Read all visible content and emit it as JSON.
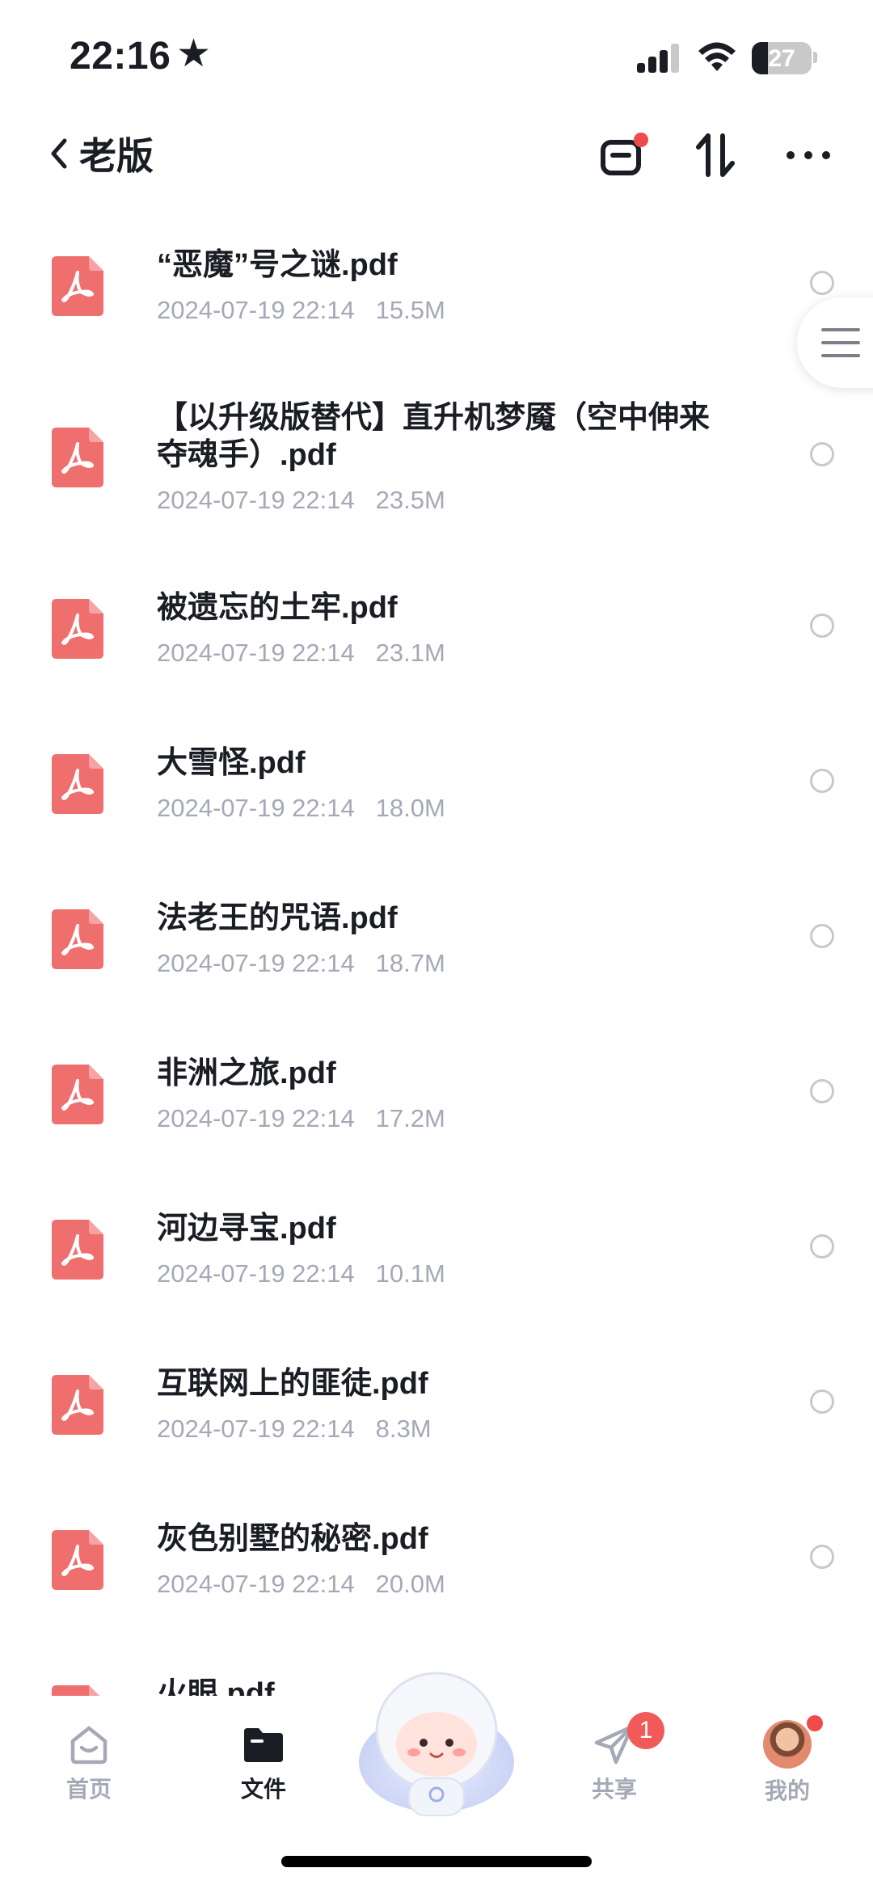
{
  "status_bar": {
    "time": "22:16",
    "star": "★",
    "battery_level": "27",
    "battery_fraction": 0.27
  },
  "header": {
    "back_label": "老版"
  },
  "files": [
    {
      "name_lines": [
        "“恶魔”号之谜.pdf"
      ],
      "date": "2024-07-19 22:14",
      "size": "15.5M"
    },
    {
      "name_lines": [
        "【以升级版替代】直升机梦魇（空中伸来",
        "夺魂手）.pdf"
      ],
      "date": "2024-07-19 22:14",
      "size": "23.5M"
    },
    {
      "name_lines": [
        "被遗忘的土牢.pdf"
      ],
      "date": "2024-07-19 22:14",
      "size": "23.1M"
    },
    {
      "name_lines": [
        "大雪怪.pdf"
      ],
      "date": "2024-07-19 22:14",
      "size": "18.0M"
    },
    {
      "name_lines": [
        "法老王的咒语.pdf"
      ],
      "date": "2024-07-19 22:14",
      "size": "18.7M"
    },
    {
      "name_lines": [
        "非洲之旅.pdf"
      ],
      "date": "2024-07-19 22:14",
      "size": "17.2M"
    },
    {
      "name_lines": [
        "河边寻宝.pdf"
      ],
      "date": "2024-07-19 22:14",
      "size": "10.1M"
    },
    {
      "name_lines": [
        "互联网上的匪徒.pdf"
      ],
      "date": "2024-07-19 22:14",
      "size": "8.3M"
    },
    {
      "name_lines": [
        "灰色别墅的秘密.pdf"
      ],
      "date": "2024-07-19 22:14",
      "size": "20.0M"
    },
    {
      "name_lines": [
        "火眼.pdf"
      ],
      "date": "",
      "size": ""
    }
  ],
  "tabs": {
    "home": "首页",
    "files": "文件",
    "share": "共享",
    "share_badge": "1",
    "mine": "我的"
  },
  "colors": {
    "accent_red": "#f04b4b",
    "pdf_icon": "#ef6e6e",
    "meta_gray": "#a5a9b6"
  }
}
